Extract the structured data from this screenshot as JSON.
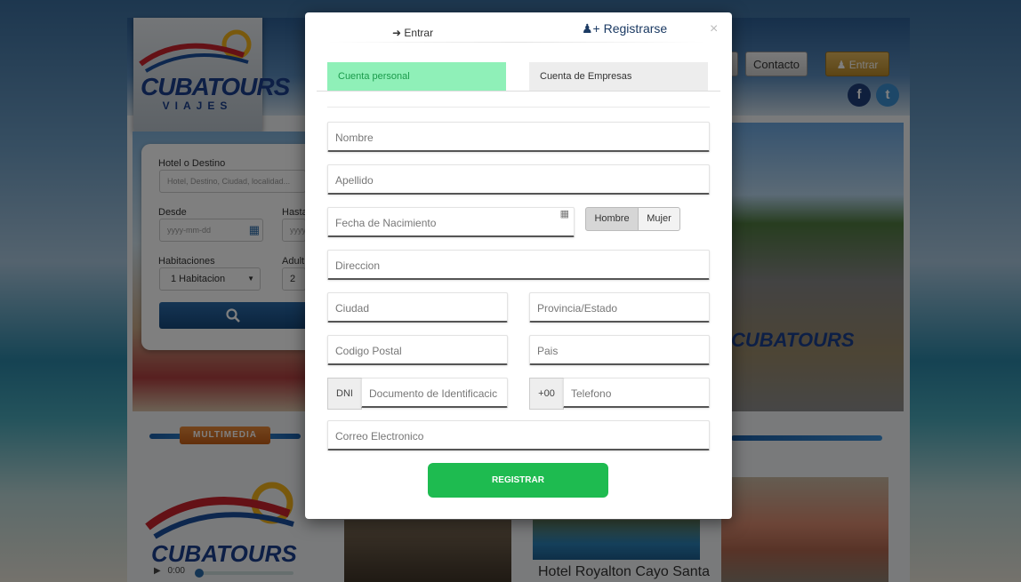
{
  "background_site": {
    "logo": {
      "brand": "CUBATOURS",
      "sub": "VIAJES"
    },
    "nav": {
      "contacto": "Contacto",
      "entrar": "Entrar"
    },
    "social": {
      "facebook": "f",
      "twitter": "t"
    },
    "search": {
      "hotel_label": "Hotel o Destino",
      "hotel_placeholder": "Hotel, Destino, Ciudad, localidad...",
      "desde_label": "Desde",
      "hasta_label": "Hasta",
      "date_placeholder": "yyyy-mm-dd",
      "date_placeholder_partial": "yyyy",
      "habitaciones_label": "Habitaciones",
      "habitaciones_value": "1 Habitacion",
      "adultos_label": "Adult",
      "adultos_value": "2"
    },
    "multimedia_label": "MULTIMEDIA",
    "audio_time": "0:00",
    "thumb_title": "Hotel Royalton Cayo Santa"
  },
  "modal": {
    "tabs": {
      "entrar": "Entrar",
      "registrarse": "Registrarse"
    },
    "account_types": {
      "personal": "Cuenta personal",
      "empresas": "Cuenta de Empresas"
    },
    "fields": {
      "nombre": "Nombre",
      "apellido": "Apellido",
      "fecha_nacimiento": "Fecha de Nacimiento",
      "direccion": "Direccion",
      "ciudad": "Ciudad",
      "provincia": "Provincia/Estado",
      "codigo_postal": "Codigo Postal",
      "pais": "Pais",
      "dni_addon": "DNI",
      "documento": "Documento de Identificacic",
      "tel_addon": "+00",
      "telefono": "Telefono",
      "correo": "Correo Electronico"
    },
    "gender": {
      "hombre": "Hombre",
      "mujer": "Mujer"
    },
    "register_button": "REGISTRAR"
  },
  "colors": {
    "accent_green": "#1ebb50",
    "tab_green_bg": "#8ff0b8",
    "brand_blue": "#1b3f8c"
  }
}
